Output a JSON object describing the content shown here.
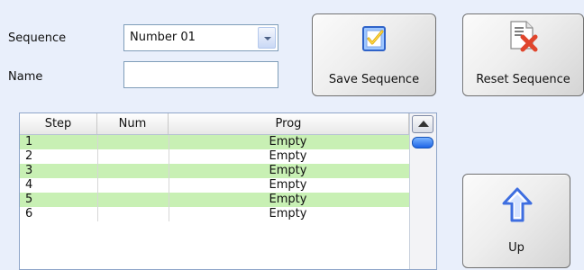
{
  "form": {
    "sequence_label": "Sequence",
    "sequence_value": "Number 01",
    "name_label": "Name",
    "name_value": ""
  },
  "buttons": {
    "save": "Save Sequence",
    "reset": "Reset Sequence",
    "up": "Up"
  },
  "table": {
    "headers": [
      "Step",
      "Num",
      "Prog"
    ],
    "rows": [
      {
        "step": "1",
        "num": "",
        "prog": "Empty"
      },
      {
        "step": "2",
        "num": "",
        "prog": "Empty"
      },
      {
        "step": "3",
        "num": "",
        "prog": "Empty"
      },
      {
        "step": "4",
        "num": "",
        "prog": "Empty"
      },
      {
        "step": "5",
        "num": "",
        "prog": "Empty"
      },
      {
        "step": "6",
        "num": "",
        "prog": "Empty"
      }
    ]
  },
  "icons": {
    "save": "checklist-icon",
    "reset": "document-delete-icon",
    "up": "up-arrow-icon",
    "dropdown": "chevron-down-icon"
  },
  "colors": {
    "background": "#e9effb",
    "row_highlight": "#c8f0b4",
    "arrow_blue": "#3e6ee0",
    "reset_x": "#e0452c"
  }
}
